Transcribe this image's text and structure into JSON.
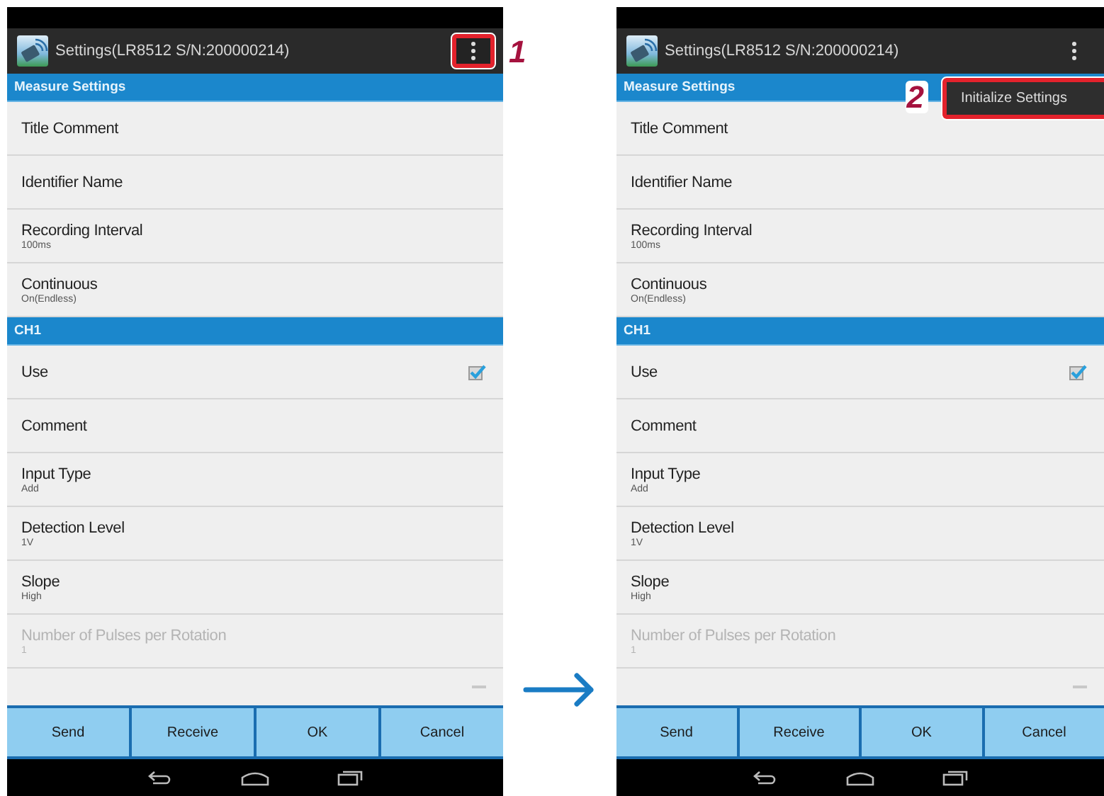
{
  "panels": [
    {
      "title": "Settings(LR8512 S/N:200000214)",
      "callout": {
        "number": "1"
      },
      "overflow_button": {
        "highlighted": true
      },
      "sections": [
        {
          "header": "Measure Settings",
          "rows": [
            {
              "kind": "text",
              "label": "Title Comment",
              "disabled": false
            },
            {
              "kind": "text",
              "label": "Identifier Name",
              "disabled": false
            },
            {
              "kind": "text",
              "label": "Recording Interval",
              "value": "100ms",
              "disabled": false
            },
            {
              "kind": "text",
              "label": "Continuous",
              "value": "On(Endless)",
              "disabled": false
            }
          ]
        },
        {
          "header": "CH1",
          "rows": [
            {
              "kind": "checkbox",
              "label": "Use",
              "checked": true,
              "disabled": false
            },
            {
              "kind": "text",
              "label": "Comment",
              "disabled": false
            },
            {
              "kind": "text",
              "label": "Input Type",
              "value": "Add",
              "disabled": false
            },
            {
              "kind": "text",
              "label": "Detection Level",
              "value": "1V",
              "disabled": false
            },
            {
              "kind": "text",
              "label": "Slope",
              "value": "High",
              "disabled": false
            },
            {
              "kind": "text",
              "label": "Number of Pulses per Rotation",
              "value": "1",
              "disabled": true
            }
          ]
        }
      ],
      "buttons": [
        "Send",
        "Receive",
        "OK",
        "Cancel"
      ]
    },
    {
      "title": "Settings(LR8512 S/N:200000214)",
      "callout": {
        "number": "2"
      },
      "overflow_button": {
        "highlighted": false
      },
      "menu": {
        "highlighted": true,
        "items": [
          "Initialize Settings"
        ]
      },
      "sections": [
        {
          "header": "Measure Settings",
          "rows": [
            {
              "kind": "text",
              "label": "Title Comment",
              "disabled": false
            },
            {
              "kind": "text",
              "label": "Identifier Name",
              "disabled": false
            },
            {
              "kind": "text",
              "label": "Recording Interval",
              "value": "100ms",
              "disabled": false
            },
            {
              "kind": "text",
              "label": "Continuous",
              "value": "On(Endless)",
              "disabled": false
            }
          ]
        },
        {
          "header": "CH1",
          "rows": [
            {
              "kind": "checkbox",
              "label": "Use",
              "checked": true,
              "disabled": false
            },
            {
              "kind": "text",
              "label": "Comment",
              "disabled": false
            },
            {
              "kind": "text",
              "label": "Input Type",
              "value": "Add",
              "disabled": false
            },
            {
              "kind": "text",
              "label": "Detection Level",
              "value": "1V",
              "disabled": false
            },
            {
              "kind": "text",
              "label": "Slope",
              "value": "High",
              "disabled": false
            },
            {
              "kind": "text",
              "label": "Number of Pulses per Rotation",
              "value": "1",
              "disabled": true
            }
          ]
        }
      ],
      "buttons": [
        "Send",
        "Receive",
        "OK",
        "Cancel"
      ]
    }
  ]
}
